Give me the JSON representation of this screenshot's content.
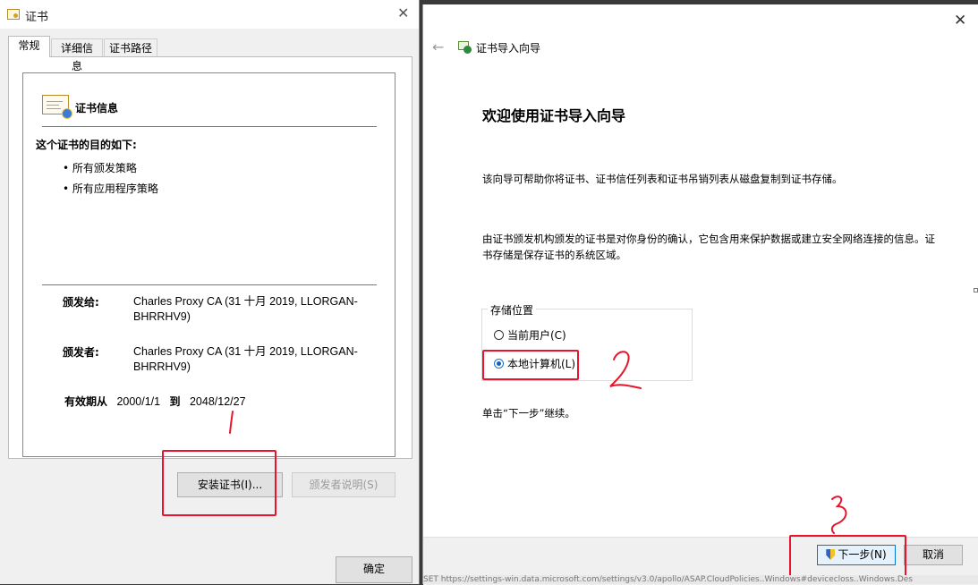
{
  "cert_dialog": {
    "title": "证书",
    "close": "✕",
    "tabs": [
      "常规",
      "详细信息",
      "证书路径"
    ],
    "info_title": "证书信息",
    "purpose_heading": "这个证书的目的如下:",
    "purposes": [
      "• 所有颁发策略",
      "• 所有应用程序策略"
    ],
    "issued_to_label": "颁发给:",
    "issued_to_value": "Charles Proxy CA (31 十月 2019, LLORGAN-BHRRHV9)",
    "issued_by_label": "颁发者:",
    "issued_by_value": "Charles Proxy CA (31 十月 2019, LLORGAN-BHRRHV9)",
    "valid_from_label": "有效期从",
    "valid_from": "2000/1/1",
    "valid_to_label": "到",
    "valid_to": "2048/12/27",
    "install_button": "安装证书(I)...",
    "issuer_statement_button": "颁发者说明(S)",
    "ok_button": "确定"
  },
  "wizard": {
    "close": "✕",
    "back": "←",
    "title": "证书导入向导",
    "heading": "欢迎使用证书导入向导",
    "intro": "该向导可帮助你将证书、证书信任列表和证书吊销列表从磁盘复制到证书存储。",
    "description": "由证书颁发机构颁发的证书是对你身份的确认，它包含用来保护数据或建立安全网络连接的信息。证书存储是保存证书的系统区域。",
    "store_location_label": "存储位置",
    "options": [
      {
        "label": "当前用户(C)",
        "selected": false
      },
      {
        "label": "本地计算机(L)",
        "selected": true
      }
    ],
    "continue_text": "单击“下一步”继续。",
    "next_button": "下一步(N)",
    "cancel_button": "取消",
    "status_strip": "SET https://settings-win.data.microsoft.com/settings/v3.0/apollo/ASAP.CloudPolicies..Windows#devicecloss..Windows.Des"
  },
  "annotations": {
    "color": "#e8142b",
    "marks": [
      "1",
      "2",
      "3"
    ]
  }
}
